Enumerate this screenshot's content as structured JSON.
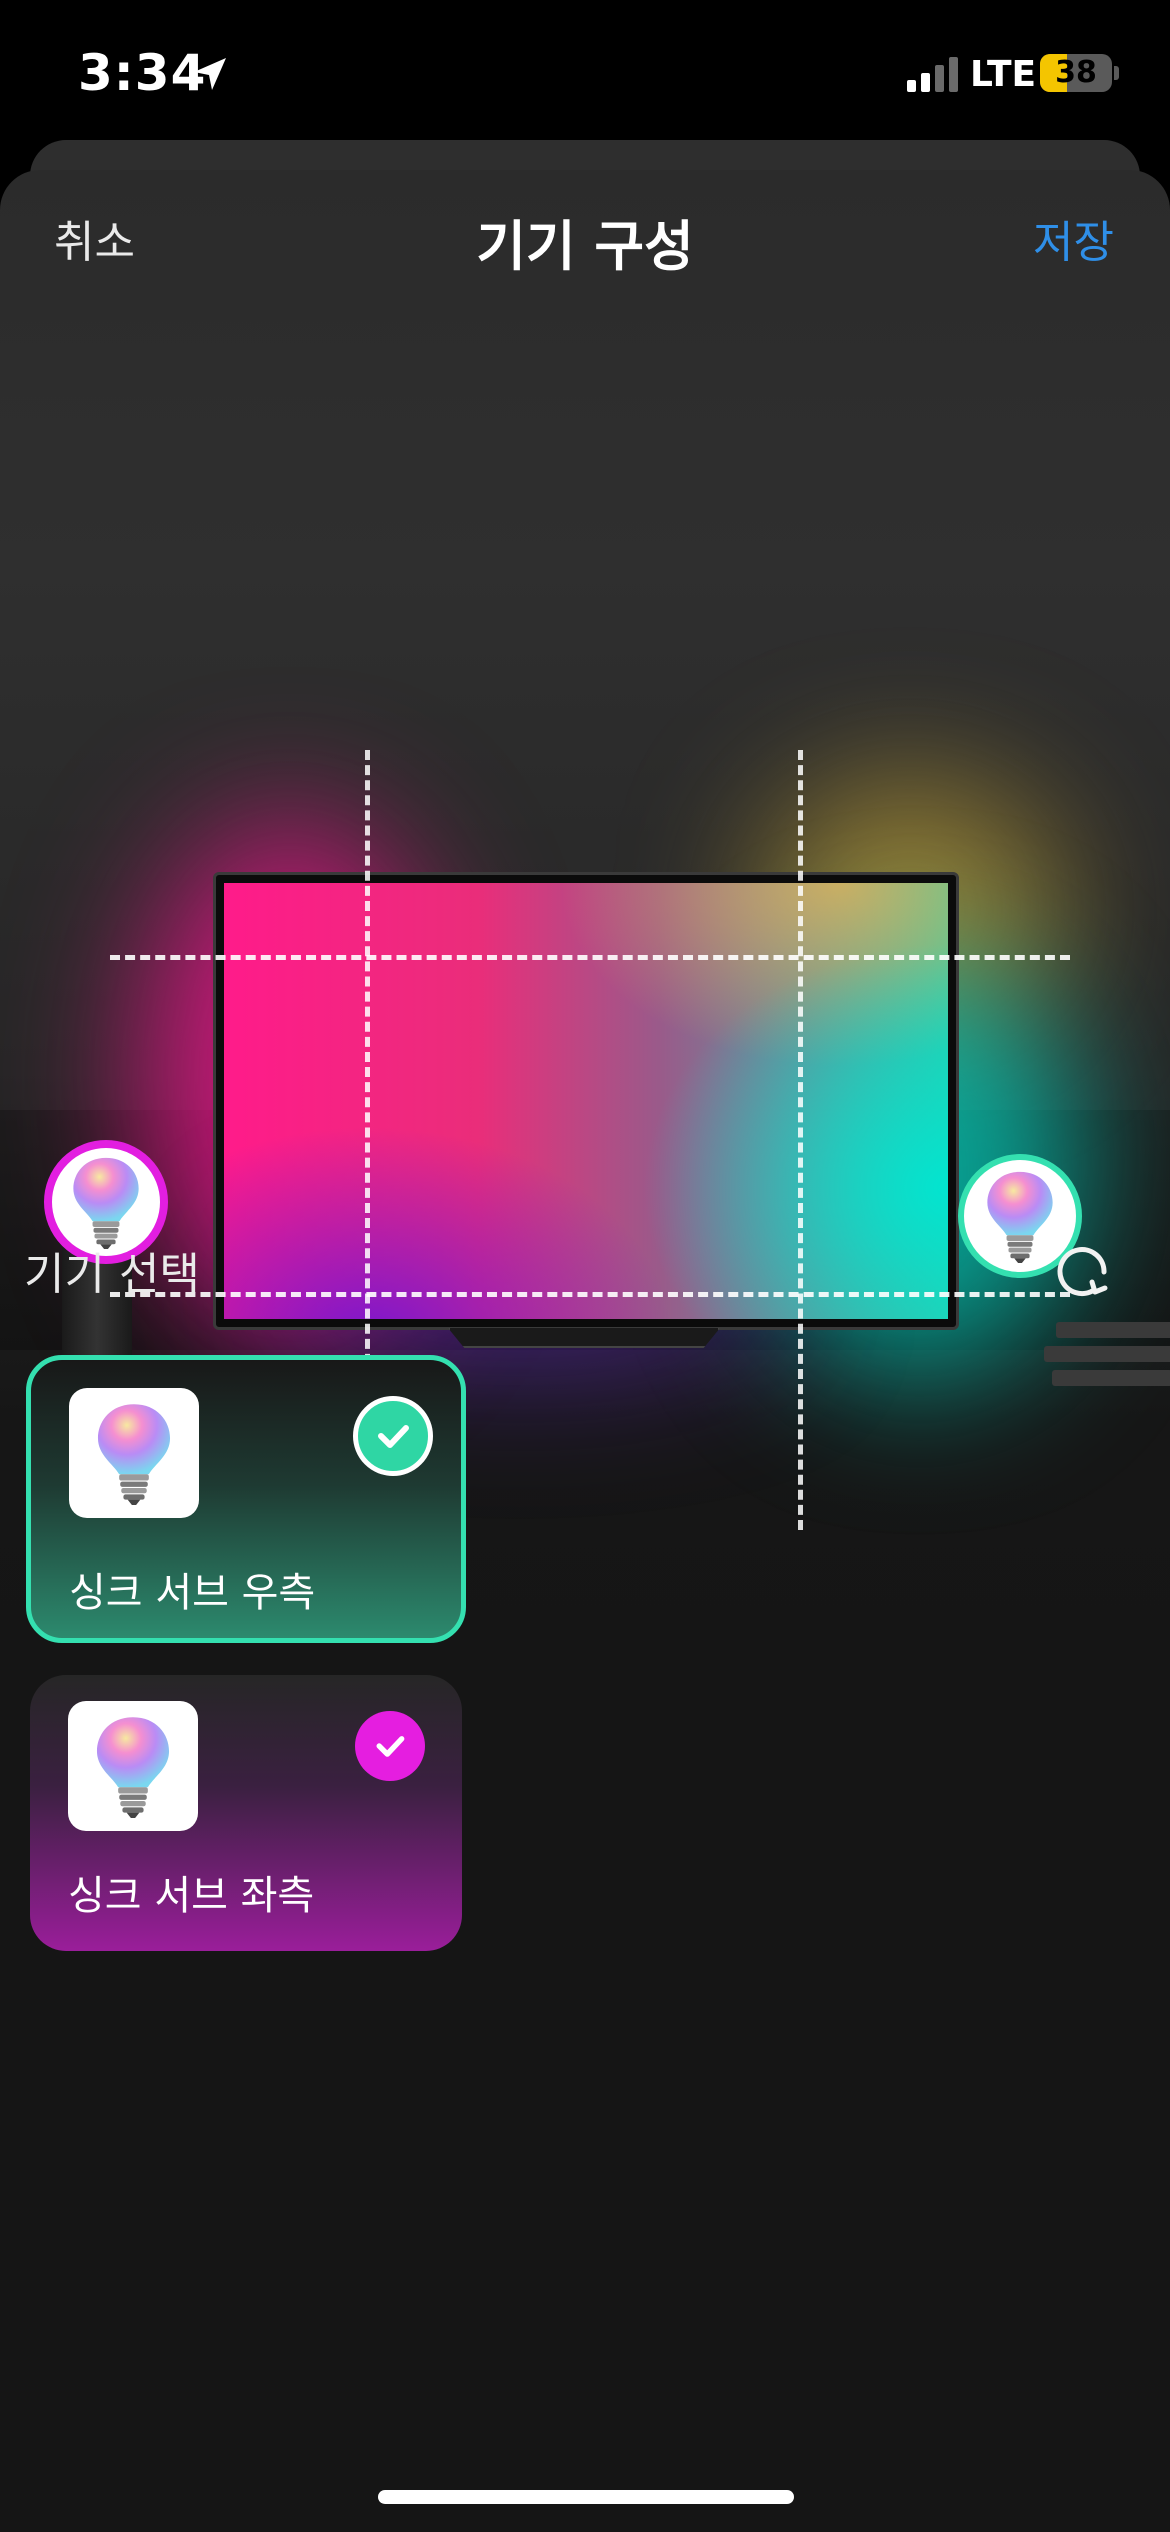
{
  "status_bar": {
    "time": "3:34",
    "network": "LTE",
    "battery_percent": "38",
    "icons": [
      "location-arrow-icon",
      "signal-icon",
      "battery-icon"
    ]
  },
  "nav": {
    "cancel_label": "취소",
    "title": "기기 구성",
    "save_label": "저장"
  },
  "scene": {
    "left_bulb_ring_color": "#e21ee0",
    "right_bulb_ring_color": "#34e0b0",
    "icons": [
      "bulb-icon",
      "bulb-icon"
    ]
  },
  "device_section": {
    "title": "기기 선택",
    "refresh_icon": "refresh-icon",
    "devices": [
      {
        "label": "싱크 서브 우측",
        "selected": true,
        "accent": "#34e0b0",
        "icon": "bulb-icon",
        "check_icon": "check-icon"
      },
      {
        "label": "싱크 서브 좌측",
        "selected": true,
        "accent": "#e51ee0",
        "icon": "bulb-icon",
        "check_icon": "check-icon"
      }
    ]
  },
  "colors": {
    "save_blue": "#2f8fe8",
    "teal": "#34e0b0",
    "magenta": "#e51ee0",
    "sheet_bg": "#2b2b2b"
  }
}
